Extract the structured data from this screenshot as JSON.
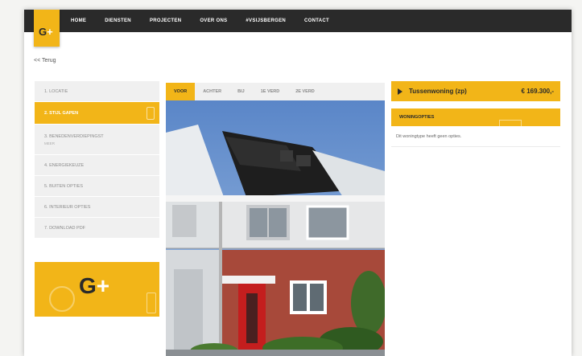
{
  "logo": {
    "letter": "G",
    "plus": "+"
  },
  "nav": {
    "items": [
      {
        "label": "HOME"
      },
      {
        "label": "DIENSTEN"
      },
      {
        "label": "PROJECTEN"
      },
      {
        "label": "OVER ONS"
      },
      {
        "label": "#VSIJSBERGEN"
      },
      {
        "label": "CONTACT"
      }
    ]
  },
  "back_link": "<< Terug",
  "steps": {
    "items": [
      {
        "label": "1. LOCATIE"
      },
      {
        "label": "2. STIJL GAPEN"
      },
      {
        "label": "3. BENEDENVERDIEPINGST",
        "sub": "MEER"
      },
      {
        "label": "4. ENERGIEKEUZE"
      },
      {
        "label": "5. BUITEN OPTIES"
      },
      {
        "label": "6. INTERIEUR OPTIES"
      },
      {
        "label": "7. DOWNLOAD PDF"
      }
    ]
  },
  "promo": {
    "letter": "G",
    "plus": "+"
  },
  "view_tabs": {
    "items": [
      {
        "label": "VOOR"
      },
      {
        "label": "ACHTER"
      },
      {
        "label": "BIJ"
      },
      {
        "label": "1E VERD"
      },
      {
        "label": "2E VERD"
      }
    ]
  },
  "price": {
    "title": "Tussenwoning (zp)",
    "value": "€ 169.300,-"
  },
  "woonopties": {
    "title": "WONINGOPTIES",
    "text": "Dit woningtype heeft geen opties."
  },
  "colors": {
    "accent": "#f2b518",
    "nav_bg": "#2a2a2a"
  }
}
